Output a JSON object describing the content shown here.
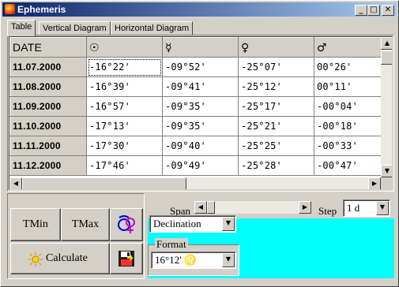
{
  "window": {
    "title": "Ephemeris",
    "controls": [
      "_",
      "□",
      "✕"
    ]
  },
  "tabs": [
    {
      "label": "Table",
      "active": true
    },
    {
      "label": "Vertical Diagram",
      "active": false
    },
    {
      "label": "Horizontal Diagram",
      "active": false
    }
  ],
  "table": {
    "columns": [
      "DATE",
      "☉",
      "☿",
      "♀",
      "♂"
    ],
    "rows": [
      {
        "date": "11.07.2000",
        "values": [
          "-16°22'",
          "-09°52'",
          "-25°07'",
          "00°26'"
        ]
      },
      {
        "date": "11.08.2000",
        "values": [
          "-16°39'",
          "-09°41'",
          "-25°12'",
          "00°11'"
        ]
      },
      {
        "date": "11.09.2000",
        "values": [
          "-16°57'",
          "-09°35'",
          "-25°17'",
          "-00°04'"
        ]
      },
      {
        "date": "11.10.2000",
        "values": [
          "-17°13'",
          "-09°35'",
          "-25°21'",
          "-00°18'"
        ]
      },
      {
        "date": "11.11.2000",
        "values": [
          "-17°30'",
          "-09°40'",
          "-25°25'",
          "-00°33'"
        ]
      },
      {
        "date": "11.12.2000",
        "values": [
          "-17°46'",
          "-09°49'",
          "-25°28'",
          "-00°47'"
        ]
      }
    ]
  },
  "controls": {
    "tmin": "TMin",
    "tmax": "TMax",
    "calculate": "Calculate",
    "span_label": "Span",
    "step_label": "Step",
    "step_value": "1 d",
    "mode_value": "Declination",
    "format_label": "Format",
    "format_value": "16°12' ♌"
  },
  "icons": {
    "calculate": "sun-icon",
    "planets": "planet-symbols-icon",
    "save": "floppy-disk-icon"
  }
}
